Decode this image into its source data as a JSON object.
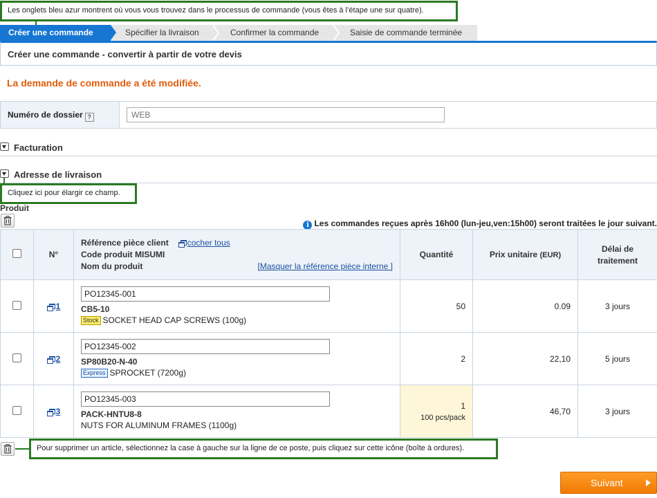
{
  "tips": {
    "tabs": "Les onglets bleu azur montrent où vous vous trouvez dans le processus de commande (vous êtes à l’étape une sur quatre).",
    "expand": "Cliquez ici pour élargir ce champ.",
    "delete": "Pour supprimer un article, sélectionnez la case à gauche sur la ligne de ce poste, puis cliquez sur cette icône (boîte à ordures)."
  },
  "steps": [
    {
      "label": "Créer une commande"
    },
    {
      "label": "Spécifier la livraison"
    },
    {
      "label": "Confirmer la commande"
    },
    {
      "label": "Saisie de commande terminée"
    }
  ],
  "page_title": "Créer une commande - convertir à partir de votre devis",
  "modified_notice": "La demande de commande a été modifiée.",
  "file_number": {
    "label": "Numéro de dossier",
    "help": "?",
    "value": "WEB"
  },
  "sections": {
    "billing": "Facturation",
    "shipping": "Adresse de livraison"
  },
  "product_label": "Produit",
  "info_notice": "Les commandes reçues après 16h00 (lun-jeu,ven:15h00) seront traitées le jour suivant.",
  "table": {
    "headers": {
      "no": "N°",
      "ref_line1": "Référence pièce client",
      "check_all": "cocher tous",
      "ref_line2": "Code produit MISUMI",
      "ref_line3": "Nom du produit",
      "hide_link": "[Masquer la référence pièce interne ]",
      "qty": "Quantité",
      "price": "Prix unitaire",
      "price_unit": "(EUR)",
      "lead_line1": "Délai de",
      "lead_line2": "traitement"
    },
    "rows": [
      {
        "no": "1",
        "ref": "PO12345-001",
        "code": "CB5-10",
        "badge": "Stock",
        "name": "SOCKET HEAD CAP SCREWS (100g)",
        "qty": "50",
        "qty_note": "",
        "price": "0.09",
        "lead": "3 jours"
      },
      {
        "no": "2",
        "ref": "PO12345-002",
        "code": "SP80B20-N-40",
        "badge": "Express",
        "name": "SPROCKET (7200g)",
        "qty": "2",
        "qty_note": "",
        "price": "22,10",
        "lead": "5 jours"
      },
      {
        "no": "3",
        "ref": "PO12345-003",
        "code": "PACK-HNTU8-8",
        "badge": "",
        "name": "NUTS FOR ALUMINUM FRAMES (1100g)",
        "qty": "1",
        "qty_note": "100 pcs/pack",
        "price": "46,70",
        "lead": "3 jours"
      }
    ]
  },
  "next_button": "Suivant"
}
